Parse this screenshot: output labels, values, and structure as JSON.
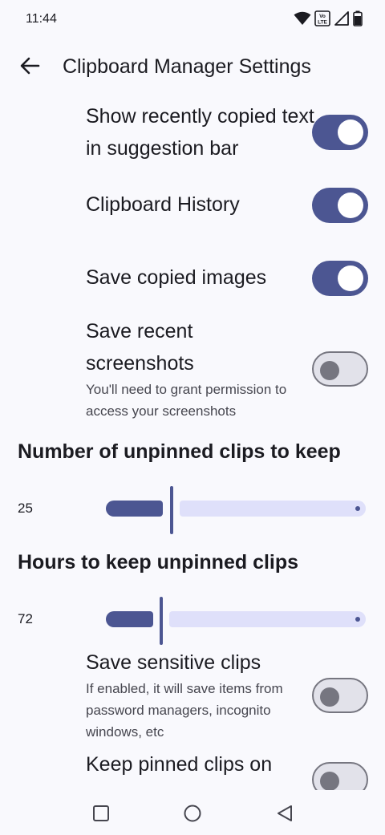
{
  "status": {
    "time": "11:44",
    "volte": "Vo LTE"
  },
  "header": {
    "title": "Clipboard Manager Settings"
  },
  "prefs": {
    "recent": {
      "title": "Show recently copied text in suggestion bar",
      "on": true
    },
    "history": {
      "title": "Clipboard History",
      "on": true
    },
    "images": {
      "title": "Save copied images",
      "on": true
    },
    "screenshots": {
      "title": "Save recent screenshots",
      "summary": "You'll need to grant permission to access your screenshots",
      "on": false
    },
    "sensitive": {
      "title": "Save sensitive clips",
      "summary": "If enabled, it will save items from password managers, incognito windows, etc",
      "on": false
    },
    "pinned": {
      "title": "Keep pinned clips on",
      "on": false
    }
  },
  "sliders": {
    "unpinned_count": {
      "title": "Number of unpinned clips to keep",
      "value": "25"
    },
    "unpinned_hours": {
      "title": "Hours to keep unpinned clips",
      "value": "72"
    }
  },
  "colors": {
    "accent": "#4c5692",
    "track": "#dfe0fa",
    "background": "#f9f9fd"
  }
}
